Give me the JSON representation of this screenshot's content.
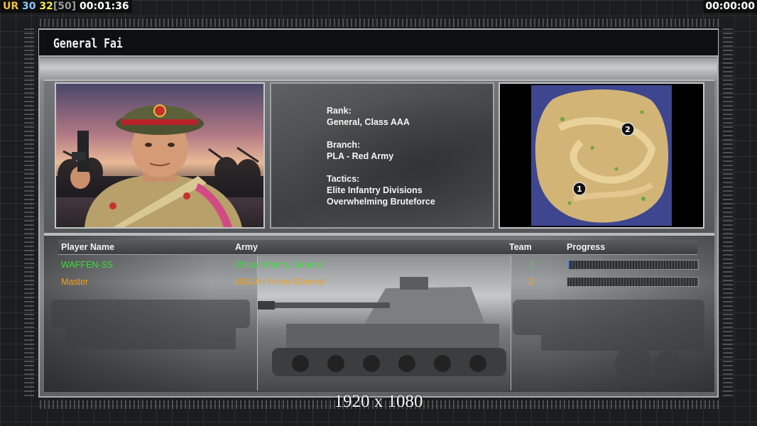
{
  "hud": {
    "ur_label": "UR",
    "fps": "30",
    "fps_limit": "32",
    "fps_cap": "[50]",
    "elapsed": "00:01:36",
    "game_timer": "00:00:00"
  },
  "general": {
    "name": "General Fai",
    "rank_label": "Rank:",
    "rank_value": "General, Class AAA",
    "branch_label": "Branch:",
    "branch_value": "PLA - Red Army",
    "tactics_label": "Tactics:",
    "tactics_1": "Elite Infantry Divisions",
    "tactics_2": "Overwhelming Bruteforce"
  },
  "map": {
    "start_1": "1",
    "start_2": "2"
  },
  "table": {
    "headers": {
      "player": "Player Name",
      "army": "Army",
      "team": "Team",
      "progress": "Progress"
    },
    "players": [
      {
        "name": "WAFFEN-SS",
        "army": "China Infantry General",
        "team": "1",
        "progress": 0.01,
        "color": "#3fdc3f"
      },
      {
        "name": "Master",
        "army": "USA Air Force General",
        "team": "2",
        "progress": 0.0,
        "color": "#f0a020"
      }
    ]
  },
  "resolution_label": "1920 x 1080"
}
